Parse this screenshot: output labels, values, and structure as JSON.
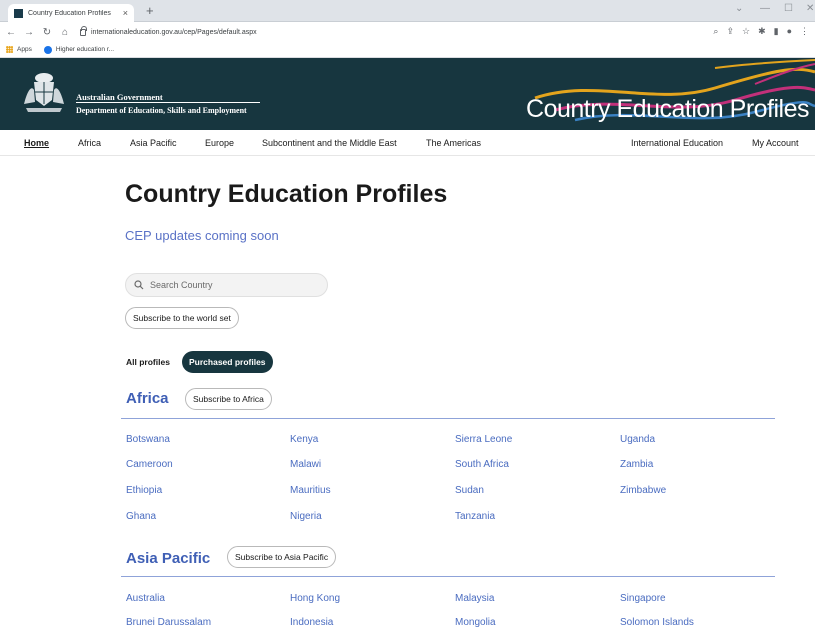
{
  "browser": {
    "tab_title": "Country Education Profiles",
    "tab_close": "×",
    "new_tab": "+",
    "url": "internationaleducation.gov.au/cep/Pages/default.aspx",
    "bookmarks": [
      "Apps",
      "Higher education r..."
    ]
  },
  "header": {
    "gov_name": "Australian Government",
    "department": "Department of Education, Skills and Employment",
    "site_title": "Country Education Profiles"
  },
  "nav": {
    "items": [
      "Home",
      "Africa",
      "Asia Pacific",
      "Europe",
      "Subcontinent and the Middle East",
      "The Americas"
    ],
    "right_items": [
      "International Education",
      "My Account"
    ]
  },
  "main": {
    "title": "Country Education Profiles",
    "updates_link": "CEP updates coming soon",
    "search_placeholder": "Search Country",
    "subscribe_world": "Subscribe to the world set",
    "toggle_all": "All profiles",
    "toggle_purchased": "Purchased profiles"
  },
  "regions": [
    {
      "name": "Africa",
      "subscribe": "Subscribe to Africa",
      "countries": [
        "Botswana",
        "Cameroon",
        "Ethiopia",
        "Ghana",
        "Kenya",
        "Malawi",
        "Mauritius",
        "Nigeria",
        "Sierra Leone",
        "South Africa",
        "Sudan",
        "Tanzania",
        "Uganda",
        "Zambia",
        "Zimbabwe"
      ]
    },
    {
      "name": "Asia Pacific",
      "subscribe": "Subscribe to Asia Pacific",
      "countries": [
        "Australia",
        "Brunei Darussalam",
        "Hong Kong",
        "Indonesia",
        "Malaysia",
        "Mongolia",
        "Singapore",
        "Solomon Islands"
      ]
    }
  ]
}
